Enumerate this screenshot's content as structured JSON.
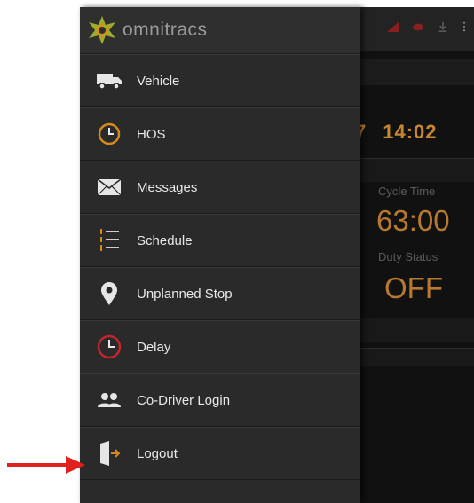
{
  "app": {
    "brand": "omnitracs",
    "time_fragment_left": "7",
    "time": "14:02",
    "cycle_time_label": "Cycle Time",
    "cycle_time_value": "63:00",
    "duty_status_label": "Duty Status",
    "duty_status_value": "OFF"
  },
  "drawer": {
    "items": [
      {
        "label": "Vehicle",
        "icon": "truck-icon"
      },
      {
        "label": "HOS",
        "icon": "clock-icon"
      },
      {
        "label": "Messages",
        "icon": "envelope-icon"
      },
      {
        "label": "Schedule",
        "icon": "list-icon"
      },
      {
        "label": "Unplanned Stop",
        "icon": "map-pin-icon"
      },
      {
        "label": "Delay",
        "icon": "clock-red-icon"
      },
      {
        "label": "Co-Driver Login",
        "icon": "users-icon"
      },
      {
        "label": "Logout",
        "icon": "exit-door-icon"
      }
    ]
  },
  "colors": {
    "accent_orange": "#c8862e",
    "delay_red": "#c0262b",
    "arrow_red": "#e0201c"
  }
}
